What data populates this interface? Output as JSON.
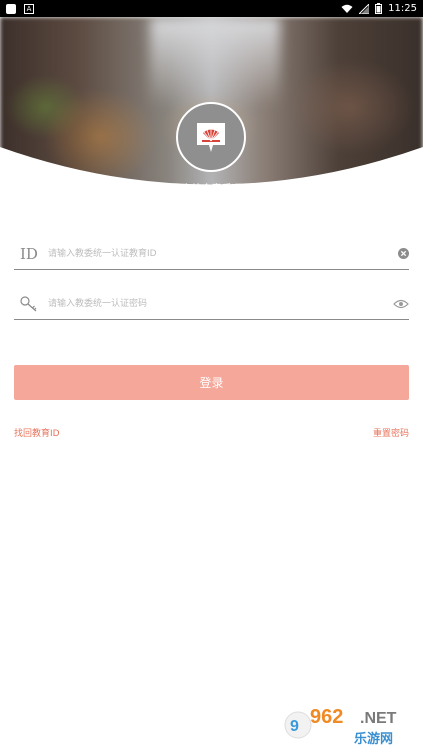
{
  "status_bar": {
    "time": "11:25"
  },
  "header": {
    "app_title": "北京综合素质评价"
  },
  "form": {
    "id_field": {
      "icon_label": "ID",
      "placeholder": "请输入教委统一认证教育ID",
      "value": ""
    },
    "password_field": {
      "placeholder": "请输入教委统一认证密码",
      "value": ""
    },
    "login_label": "登录",
    "find_id_label": "找回教育ID",
    "reset_password_label": "重置密码"
  },
  "watermark": {
    "brand_number": "962",
    "brand_suffix": ".NET",
    "brand_cn": "乐游网"
  },
  "colors": {
    "accent": "#f5a79a",
    "link": "#e8745d",
    "logo_red": "#d9443a"
  }
}
